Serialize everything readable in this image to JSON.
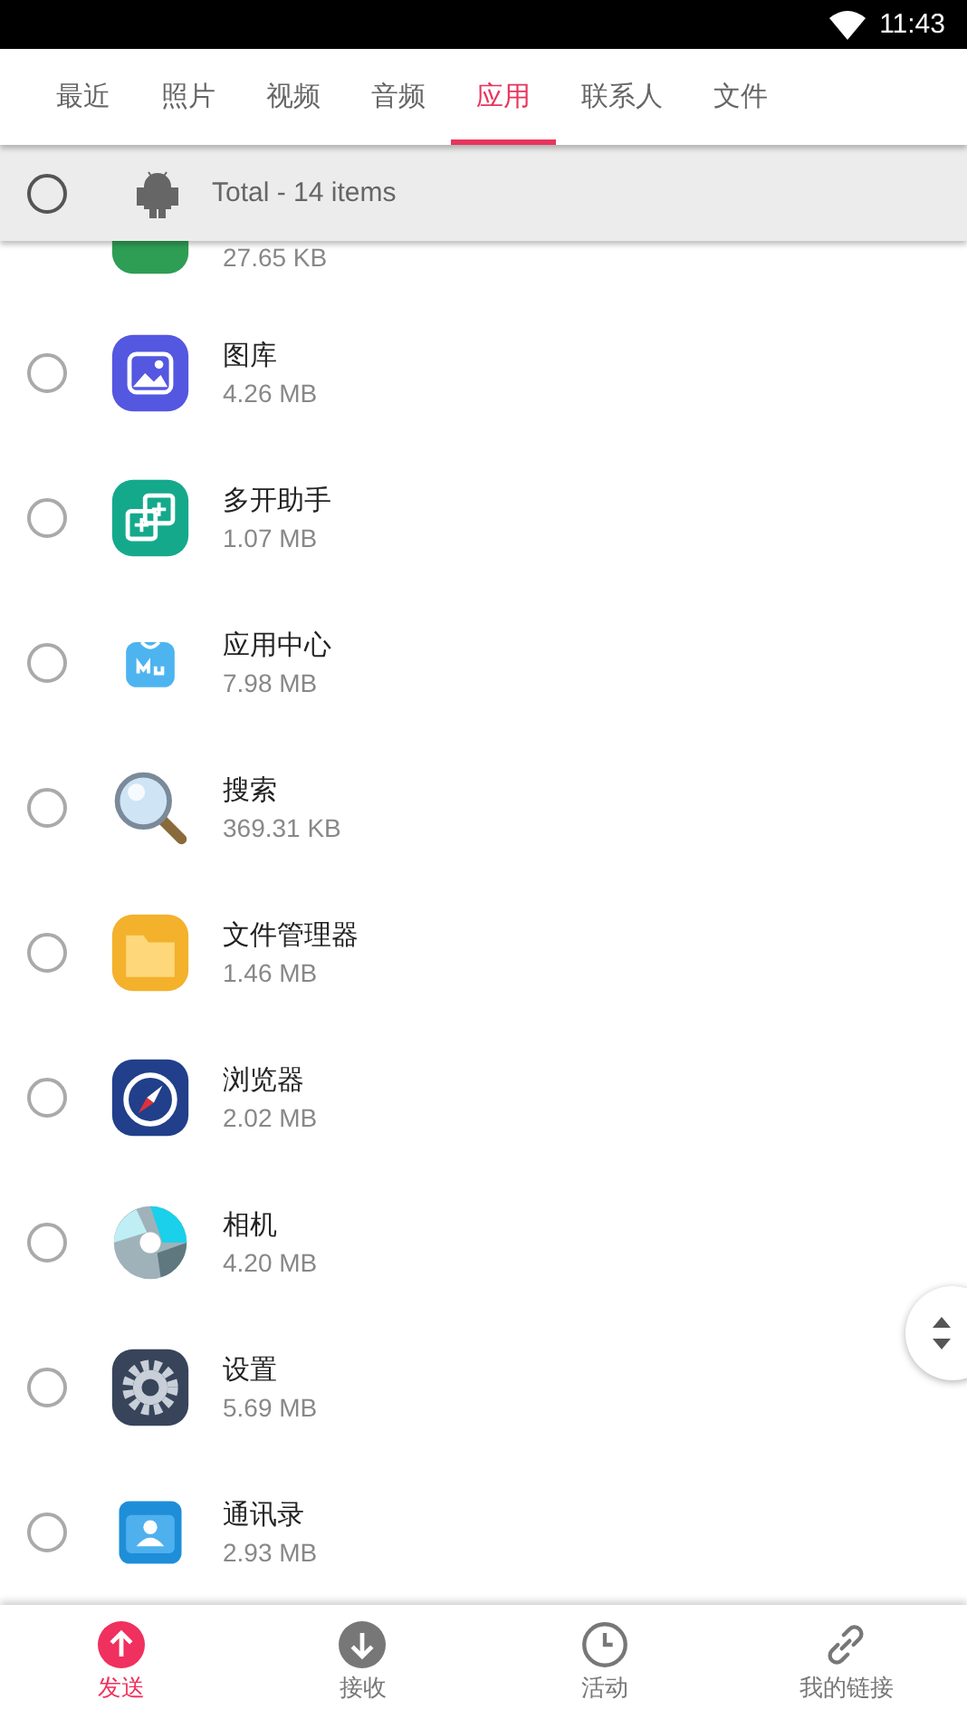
{
  "status_bar": {
    "time": "11:43"
  },
  "tabs": [
    {
      "label": "最近",
      "selected": false
    },
    {
      "label": "照片",
      "selected": false
    },
    {
      "label": "视频",
      "selected": false
    },
    {
      "label": "音频",
      "selected": false
    },
    {
      "label": "应用",
      "selected": true
    },
    {
      "label": "联系人",
      "selected": false
    },
    {
      "label": "文件",
      "selected": false
    }
  ],
  "header": {
    "checked": false,
    "label": "Total - 14 items"
  },
  "apps": [
    {
      "kind": "green",
      "size": "27.65 KB"
    },
    {
      "kind": "gallery",
      "name": "图库",
      "size": "4.26 MB",
      "checked": false
    },
    {
      "kind": "clone",
      "name": "多开助手",
      "size": "1.07 MB",
      "checked": false
    },
    {
      "kind": "store",
      "name": "应用中心",
      "size": "7.98 MB",
      "checked": false
    },
    {
      "kind": "search",
      "name": "搜索",
      "size": "369.31 KB",
      "checked": false
    },
    {
      "kind": "folder",
      "name": "文件管理器",
      "size": "1.46 MB",
      "checked": false
    },
    {
      "kind": "compass",
      "name": "浏览器",
      "size": "2.02 MB",
      "checked": false
    },
    {
      "kind": "camera",
      "name": "相机",
      "size": "4.20 MB",
      "checked": false
    },
    {
      "kind": "gear",
      "name": "设置",
      "size": "5.69 MB",
      "checked": false
    },
    {
      "kind": "contacts",
      "name": "通讯录",
      "size": "2.93 MB",
      "checked": false
    }
  ],
  "bottom_nav": [
    {
      "kind": "send",
      "label": "发送",
      "selected": true
    },
    {
      "kind": "receive",
      "label": "接收",
      "selected": false
    },
    {
      "kind": "activity",
      "label": "活动",
      "selected": false
    },
    {
      "kind": "link",
      "label": "我的链接",
      "selected": false
    }
  ]
}
